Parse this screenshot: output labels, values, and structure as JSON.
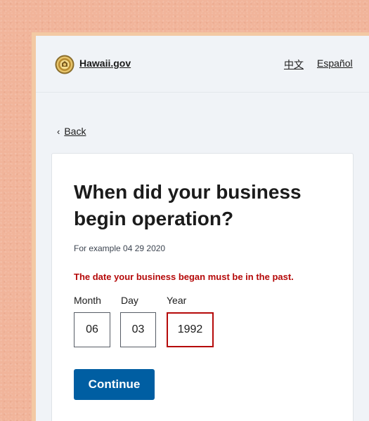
{
  "header": {
    "site_name": "Hawaii.gov",
    "languages": [
      "中文",
      "Español"
    ]
  },
  "nav": {
    "back_label": "Back"
  },
  "form": {
    "title": "When did your business begin operation?",
    "hint": "For example 04 29 2020",
    "error": "The date your business began must be in the past.",
    "fields": {
      "month": {
        "label": "Month",
        "value": "06"
      },
      "day": {
        "label": "Day",
        "value": "03"
      },
      "year": {
        "label": "Year",
        "value": "1992"
      }
    },
    "submit_label": "Continue"
  },
  "colors": {
    "primary": "#005ea2",
    "error": "#b50909",
    "background": "#f1b49a"
  }
}
